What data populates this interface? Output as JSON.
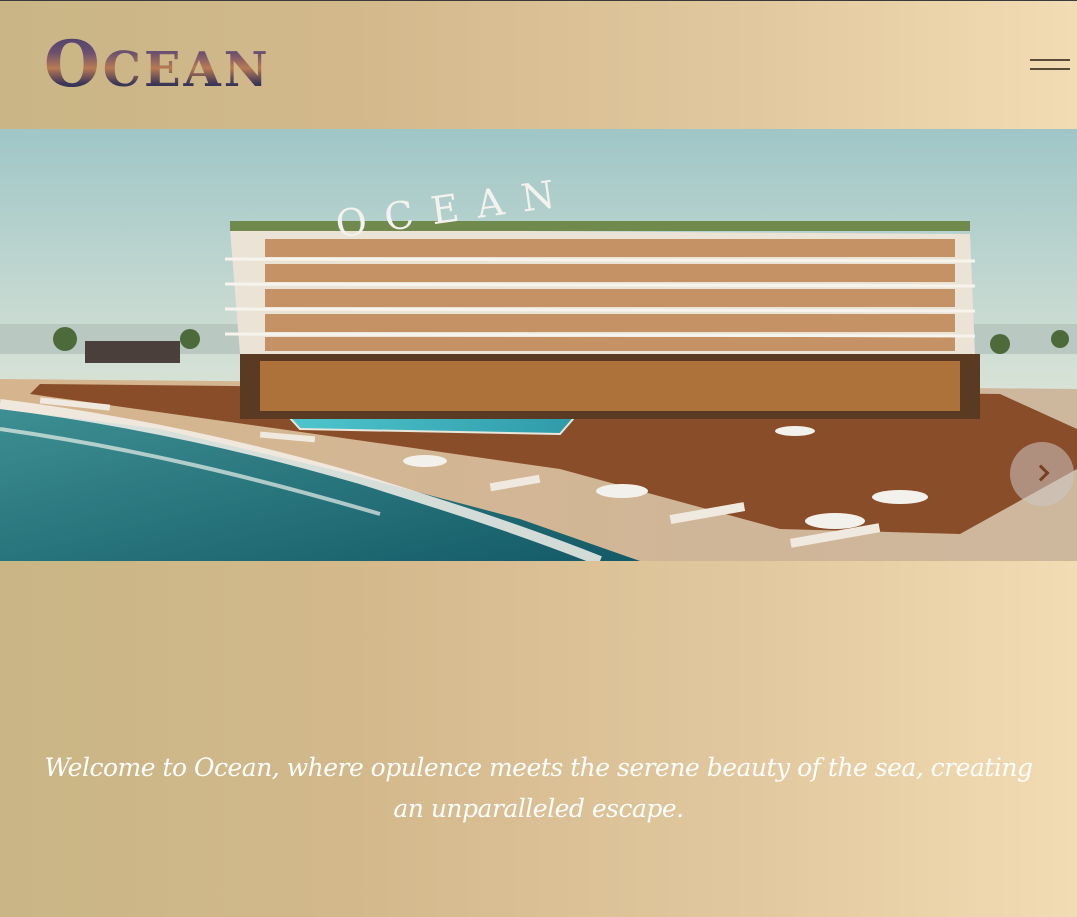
{
  "header": {
    "logo_initial": "O",
    "logo_rest": "CEAN",
    "menu_icon": "hamburger-icon"
  },
  "hero": {
    "sign_text": "OCEAN",
    "next_icon": "chevron-right-icon"
  },
  "tagline": "Welcome to Ocean, where opulence meets the serene beauty of the sea, creating an unparalleled escape.",
  "colors": {
    "background_start": "#c9b585",
    "background_end": "#f2dcb3",
    "tagline_text": "#ffffff",
    "chevron": "#7a3e20"
  }
}
